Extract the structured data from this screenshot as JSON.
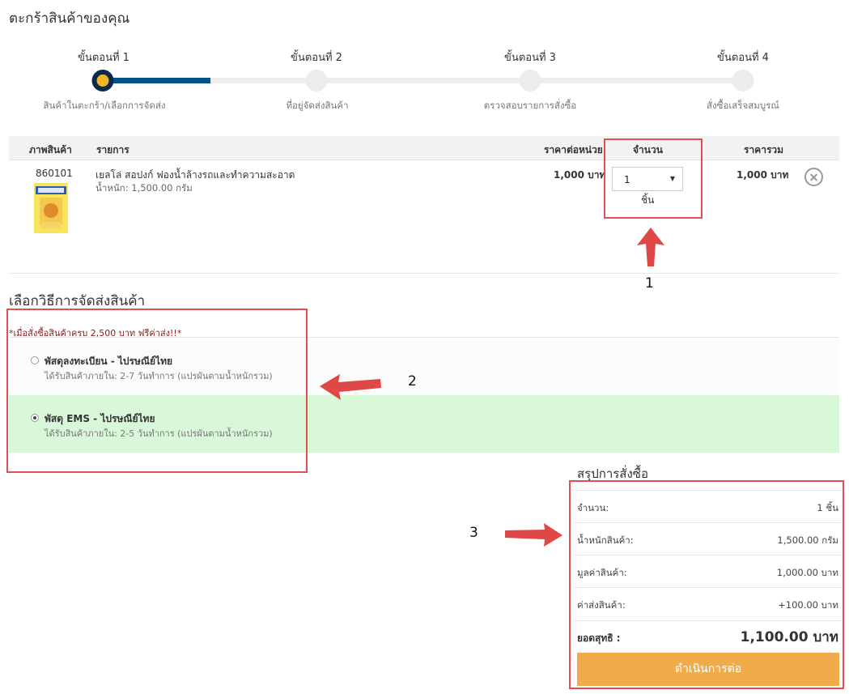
{
  "page": {
    "title": "ตะกร้าสินค้าของคุณ"
  },
  "steps": [
    {
      "label": "ขั้นตอนที่ 1",
      "sub": "สินค้าในตะกร้า/เลือกการจัดส่ง"
    },
    {
      "label": "ขั้นตอนที่ 2",
      "sub": "ที่อยู่จัดส่งสินค้า"
    },
    {
      "label": "ขั้นตอนที่ 3",
      "sub": "ตรวจสอบรายการสั่งซื้อ"
    },
    {
      "label": "ขั้นตอนที่ 4",
      "sub": "สั่งซื้อเสร็จสมบูรณ์"
    }
  ],
  "cart": {
    "headers": {
      "image": "ภาพสินค้า",
      "item": "รายการ",
      "unit_price": "ราคาต่อหน่วย",
      "qty": "จำนวน",
      "total": "ราคารวม"
    },
    "items": [
      {
        "code": "860101",
        "name": "เยลโล่ สอปงก์ ฟองน้ำล้างรถและทำความสะอาด",
        "weight": "น้ำหนัก: 1,500.00 กรัม",
        "unit_price": "1,000 บาท",
        "qty": "1",
        "qty_unit": "ชิ้น",
        "total": "1,000 บาท"
      }
    ]
  },
  "shipping": {
    "title": "เลือกวิธีการจัดส่งสินค้า",
    "note": "*เมื่อสั่งซื้อสินค้าครบ 2,500 บาท ฟรีค่าส่ง!!*",
    "options": [
      {
        "name": "พัสดุลงทะเบียน - ไปรษณีย์ไทย",
        "desc": "ได้รับสินค้าภายใน: 2-7 วันทำการ (แปรผันตามน้ำหนักรวม)",
        "selected": false
      },
      {
        "name": "พัสดุ EMS - ไปรษณีย์ไทย",
        "desc": "ได้รับสินค้าภายใน: 2-5 วันทำการ (แปรผันตามน้ำหนักรวม)",
        "selected": true
      }
    ]
  },
  "summary": {
    "title": "สรุปการสั่งซื้อ",
    "rows": [
      {
        "label": "จำนวน:",
        "value": "1 ชิ้น"
      },
      {
        "label": "น้ำหนักสินค้า:",
        "value": "1,500.00 กรัม"
      },
      {
        "label": "มูลค่าสินค้า:",
        "value": "1,000.00 บาท"
      },
      {
        "label": "ค่าส่งสินค้า:",
        "value": "+100.00 บาท"
      }
    ],
    "total_label": "ยอดสุทธิ :",
    "total_value": "1,100.00 บาท",
    "proceed_label": "ดำเนินการต่อ"
  },
  "annotations": {
    "n1": "1",
    "n2": "2",
    "n3": "3"
  },
  "colors": {
    "accent": "#00538a",
    "step_dot": "#f0b429",
    "button": "#f0ab4b",
    "selected_row": "#d9f7d9",
    "highlight": "#e05050"
  }
}
